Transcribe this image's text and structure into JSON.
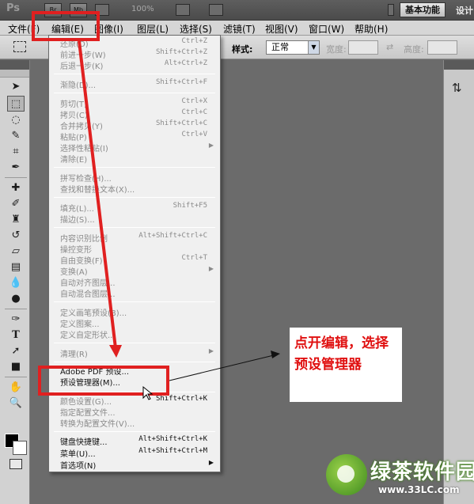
{
  "appbar": {
    "logo": "Ps",
    "icons": [
      "Br",
      "Mb"
    ],
    "zoom": "100%",
    "workspace": "基本功能",
    "design": "设计"
  },
  "menubar": {
    "items": [
      "文件(F)",
      "编辑(E)",
      "图像(I)",
      "图层(L)",
      "选择(S)",
      "滤镜(T)",
      "视图(V)",
      "窗口(W)",
      "帮助(H)"
    ]
  },
  "options": {
    "style_label": "样式:",
    "style_value": "正常",
    "width_label": "宽度:",
    "height_label": "高度:"
  },
  "edit_menu": {
    "items": [
      {
        "label": "还原(O)",
        "shortcut": "Ctrl+Z"
      },
      {
        "label": "前进一步(W)",
        "shortcut": "Shift+Ctrl+Z"
      },
      {
        "label": "后退一步(K)",
        "shortcut": "Alt+Ctrl+Z"
      },
      {
        "label": "渐隐(D)...",
        "shortcut": "Shift+Ctrl+F"
      },
      {
        "label": "剪切(T)",
        "shortcut": "Ctrl+X"
      },
      {
        "label": "拷贝(C)",
        "shortcut": "Ctrl+C"
      },
      {
        "label": "合并拷贝(Y)",
        "shortcut": "Shift+Ctrl+C"
      },
      {
        "label": "粘贴(P)",
        "shortcut": "Ctrl+V"
      },
      {
        "label": "选择性粘贴(I)",
        "shortcut": ""
      },
      {
        "label": "清除(E)",
        "shortcut": ""
      },
      {
        "label": "拼写检查(H)...",
        "shortcut": ""
      },
      {
        "label": "查找和替换文本(X)...",
        "shortcut": ""
      },
      {
        "label": "填充(L)...",
        "shortcut": "Shift+F5"
      },
      {
        "label": "描边(S)...",
        "shortcut": ""
      },
      {
        "label": "内容识别比例",
        "shortcut": "Alt+Shift+Ctrl+C"
      },
      {
        "label": "操控变形",
        "shortcut": ""
      },
      {
        "label": "自由变换(F)",
        "shortcut": "Ctrl+T"
      },
      {
        "label": "变换(A)",
        "shortcut": ""
      },
      {
        "label": "自动对齐图层...",
        "shortcut": ""
      },
      {
        "label": "自动混合图层...",
        "shortcut": ""
      },
      {
        "label": "定义画笔预设(B)...",
        "shortcut": ""
      },
      {
        "label": "定义图案...",
        "shortcut": ""
      },
      {
        "label": "定义自定形状...",
        "shortcut": ""
      },
      {
        "label": "清理(R)",
        "shortcut": ""
      },
      {
        "label": "Adobe PDF 预设...",
        "shortcut": ""
      },
      {
        "label": "预设管理器(M)...",
        "shortcut": ""
      },
      {
        "label": "颜色设置(G)...",
        "shortcut": "Shift+Ctrl+K"
      },
      {
        "label": "指定配置文件...",
        "shortcut": ""
      },
      {
        "label": "转换为配置文件(V)...",
        "shortcut": ""
      },
      {
        "label": "键盘快捷键...",
        "shortcut": "Alt+Shift+Ctrl+K"
      },
      {
        "label": "菜单(U)...",
        "shortcut": "Alt+Shift+Ctrl+M"
      },
      {
        "label": "首选项(N)",
        "shortcut": ""
      }
    ]
  },
  "annotation": {
    "callout_text": "点开编辑，选择预设管理器",
    "red_color": "#e02020"
  },
  "watermark": {
    "text": "绿茶软件园",
    "url": "www.33LC.com"
  }
}
